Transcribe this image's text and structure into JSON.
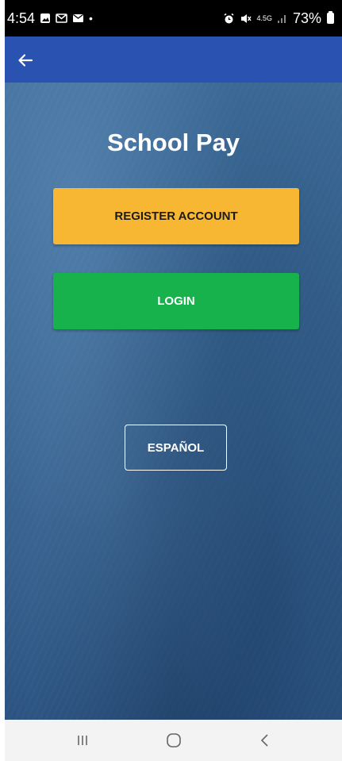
{
  "status_bar": {
    "time": "4:54",
    "network": "4.5G",
    "battery": "73%",
    "left_icons": [
      "gallery-icon",
      "gmail-icon",
      "message-icon",
      "dot-icon"
    ],
    "right_icons": [
      "alarm-icon",
      "mute-icon",
      "network-icon",
      "signal-icon",
      "battery-icon"
    ]
  },
  "app_bar": {
    "back_icon": "arrow-left-icon",
    "color": "#2a52b0"
  },
  "main": {
    "title": "School Pay",
    "register_label": "REGISTER ACCOUNT",
    "login_label": "LOGIN",
    "language_label": "ESPAÑOL"
  },
  "colors": {
    "register": "#f7b733",
    "login": "#18b24d",
    "background": "#386593"
  },
  "nav_bar": {
    "icons": [
      "recent-apps-icon",
      "home-icon",
      "back-icon"
    ]
  }
}
